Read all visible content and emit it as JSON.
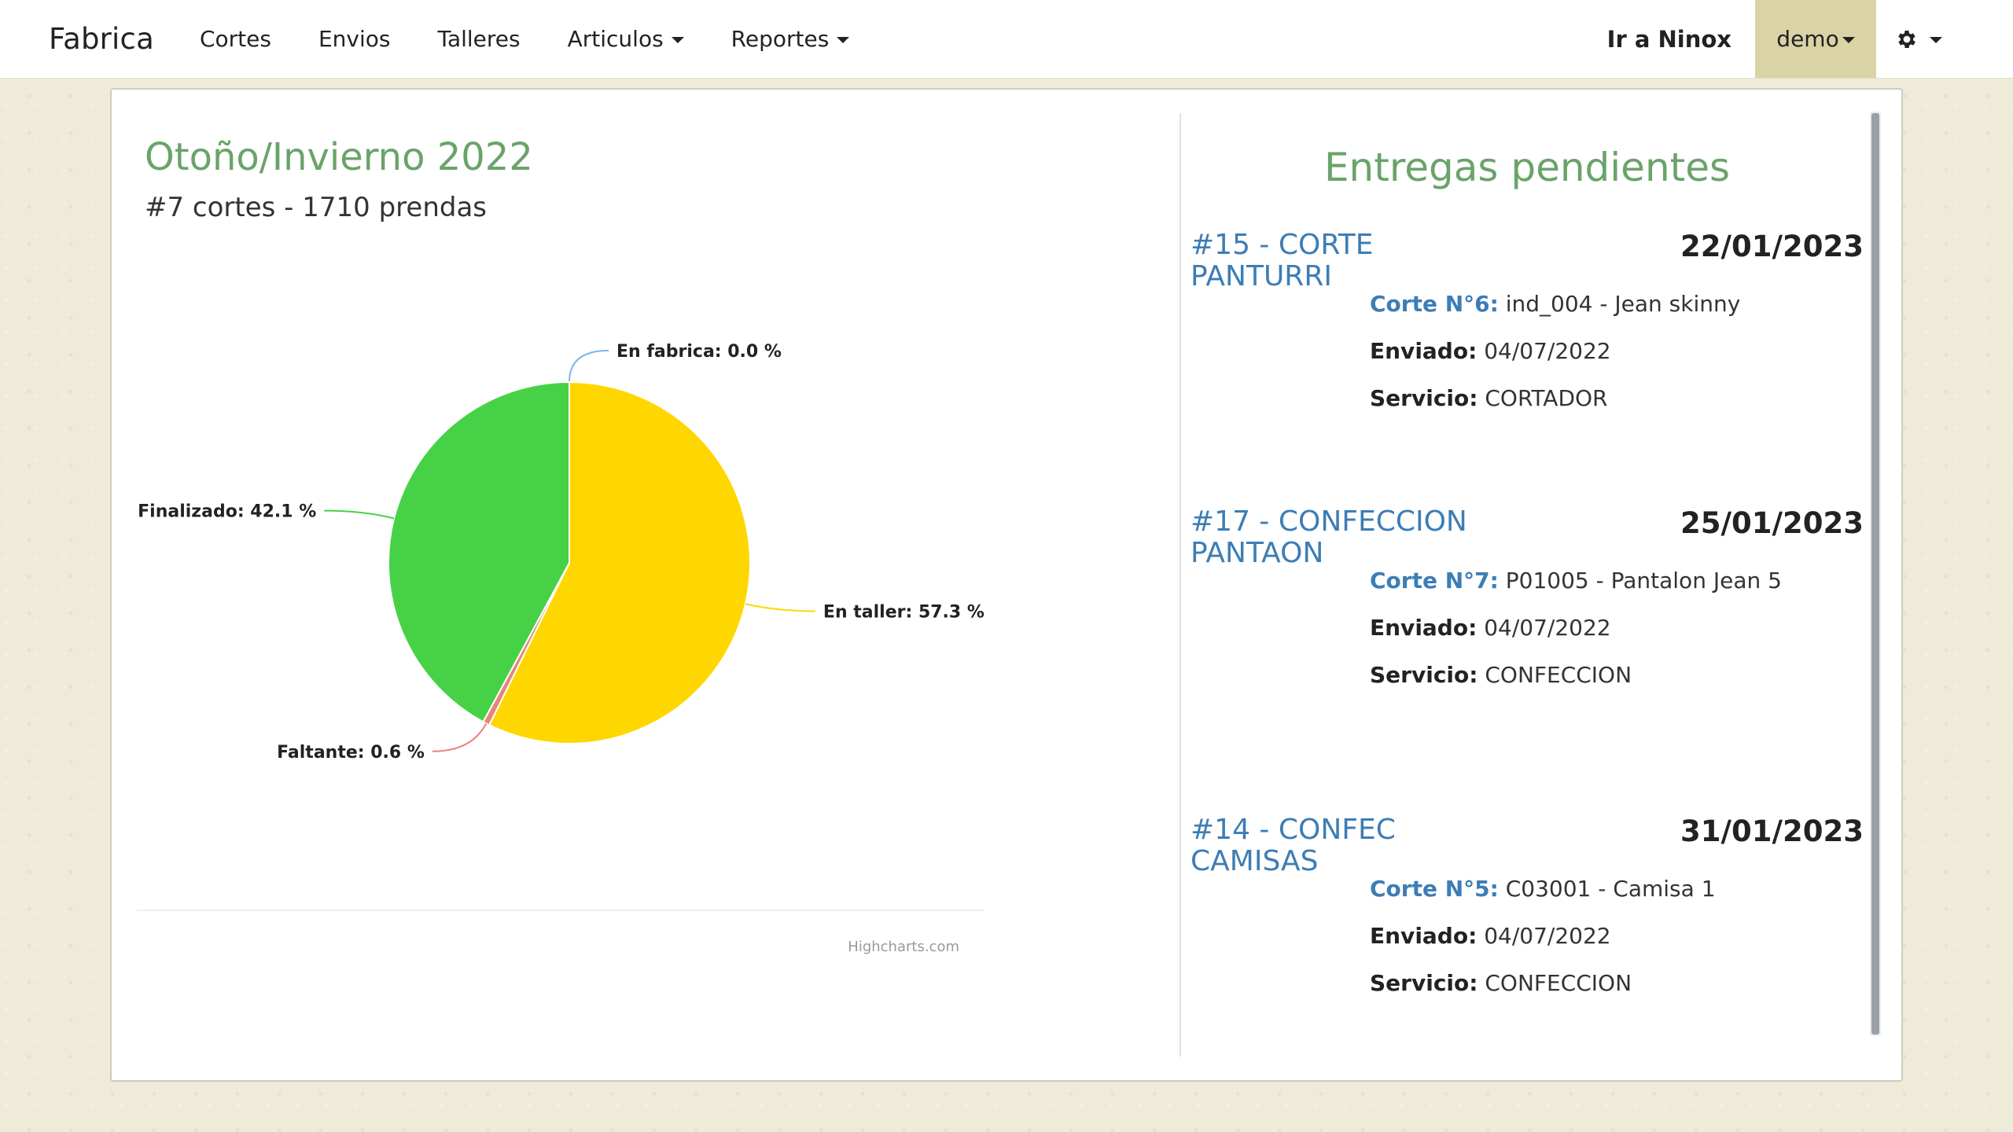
{
  "navbar": {
    "brand": "Fabrica",
    "items": [
      {
        "label": "Cortes"
      },
      {
        "label": "Envios"
      },
      {
        "label": "Talleres"
      },
      {
        "label": "Articulos"
      },
      {
        "label": "Reportes"
      }
    ],
    "ninox_label": "Ir a Ninox",
    "user_label": "demo",
    "settings_icon": "gear-icon"
  },
  "season": {
    "title": "Otoño/Invierno 2022",
    "subtitle": "#7 cortes - 1710 prendas"
  },
  "chart_data": {
    "type": "pie",
    "slices": [
      {
        "label": "En fabrica: 0.0 %",
        "name": "En fabrica",
        "value": 0.0,
        "color": "#7cb5ec"
      },
      {
        "label": "En taller: 57.3 %",
        "name": "En taller",
        "value": 57.3,
        "color": "#ffd700"
      },
      {
        "label": "Faltante: 0.6 %",
        "name": "Faltante",
        "value": 0.6,
        "color": "#e8847a"
      },
      {
        "label": "Finalizado: 42.1 %",
        "name": "Finalizado",
        "value": 42.1,
        "color": "#47d147"
      }
    ],
    "credits": "Highcharts.com"
  },
  "deliveries": {
    "title": "Entregas pendientes",
    "items": [
      {
        "title": "#15 - CORTE PANTURRI",
        "date": "22/01/2023",
        "corte_label": "Corte N°6:",
        "corte_value": "ind_004 - Jean skinny",
        "enviado_label": "Enviado:",
        "enviado_value": "04/07/2022",
        "servicio_label": "Servicio:",
        "servicio_value": "CORTADOR"
      },
      {
        "title": "#17 - CONFECCION PANTAON",
        "date": "25/01/2023",
        "corte_label": "Corte N°7:",
        "corte_value": "P01005 - Pantalon Jean 5",
        "enviado_label": "Enviado:",
        "enviado_value": "04/07/2022",
        "servicio_label": "Servicio:",
        "servicio_value": "CONFECCION"
      },
      {
        "title": "#14 - CONFEC CAMISAS",
        "date": "31/01/2023",
        "corte_label": "Corte N°5:",
        "corte_value": "C03001 - Camisa 1",
        "enviado_label": "Enviado:",
        "enviado_value": "04/07/2022",
        "servicio_label": "Servicio:",
        "servicio_value": "CONFECCION"
      }
    ]
  }
}
